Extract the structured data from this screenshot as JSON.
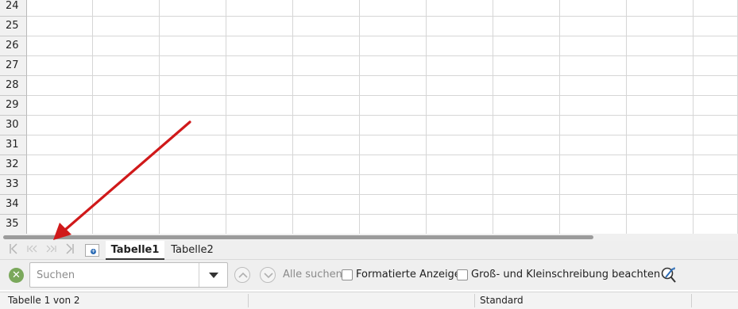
{
  "grid": {
    "rows": [
      "24",
      "25",
      "26",
      "27",
      "28",
      "29",
      "30",
      "31",
      "32",
      "33",
      "34",
      "35"
    ]
  },
  "sheet_nav": {
    "first_icon": "first-sheet-icon",
    "prev_icon": "previous-sheet-icon",
    "next_icon": "next-sheet-icon",
    "last_icon": "last-sheet-icon",
    "add_icon": "add-sheet-icon"
  },
  "sheet_tabs": [
    {
      "label": "Tabelle1",
      "active": true
    },
    {
      "label": "Tabelle2",
      "active": false
    }
  ],
  "find_toolbar": {
    "close_icon": "close-find-toolbar-icon",
    "search_placeholder": "Suchen",
    "search_value": "",
    "find_all_label": "Alle suchen",
    "formatted_display_label": "Formatierte Anzeige",
    "match_case_label": "Groß- und Kleinschreibung beachten",
    "formatted_display_checked": false,
    "match_case_checked": false
  },
  "status_bar": {
    "sheet_position": "Tabelle 1 von 2",
    "page_style": "Standard"
  },
  "colors": {
    "annotation_arrow": "#d0191a",
    "close_button": "#7aa85b",
    "add_sheet_accent": "#2a6bb5"
  }
}
